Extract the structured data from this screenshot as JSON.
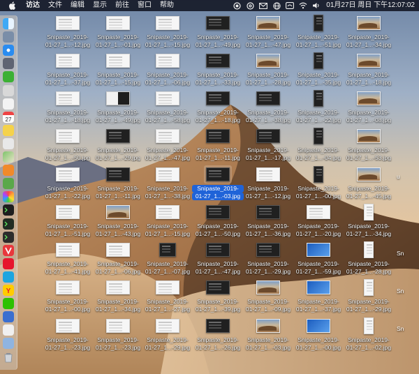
{
  "menubar": {
    "app_name": "访达",
    "items": [
      "文件",
      "编辑",
      "显示",
      "前往",
      "窗口",
      "帮助"
    ],
    "clock": "01月27日 周日 下午12:07:02",
    "tray_icons": [
      "record-icon",
      "bullseye-icon",
      "mail-icon",
      "globe-icon",
      "hotspot-icon",
      "wifi-icon",
      "volume-icon"
    ]
  },
  "dock": {
    "apps": [
      "finder-icon",
      "launchpad-icon",
      "safari-icon",
      "rocket-icon",
      "wechat-icon",
      "notes-icon",
      "reminders-icon",
      "calendar-icon",
      "notes-yellow-icon",
      "preview-icon",
      "maps-icon",
      "books-icon",
      "time-machine-icon",
      "photos-icon",
      "terminal-icon",
      "activity-monitor-icon",
      "console-icon",
      "vivaldi-icon",
      "weibo-icon",
      "browser-icon",
      "yandex-icon",
      "wechat-green-icon",
      "keynote-icon",
      "document-icon",
      "downloads-icon",
      "trash-icon"
    ]
  },
  "desktop": {
    "rows": [
      [
        {
          "line1": "Snipaste_2019-",
          "line2": "01-27_1...-12.jpg",
          "thumb": "light",
          "shape": "wide"
        },
        {
          "line1": "Snipaste_2019-",
          "line2": "01-27_1...-01.jpg",
          "thumb": "light",
          "shape": "wide"
        },
        {
          "line1": "Snipaste_2019-",
          "line2": "01-27_1...-15.jpg",
          "thumb": "light",
          "shape": "wide"
        },
        {
          "line1": "Snipaste_2019-",
          "line2": "01-27_1...-49.jpg",
          "thumb": "dark",
          "shape": "wide"
        },
        {
          "line1": "Snipaste_2019-",
          "line2": "01-27_1...-47.jpg",
          "thumb": "photo",
          "shape": "wide"
        },
        {
          "line1": "Snipaste_2019-",
          "line2": "01-27_1...-51.jpg",
          "thumb": "dark",
          "shape": "tall"
        },
        {
          "line1": "Snipaste_2019-",
          "line2": "01-27_1...-34.jpg",
          "thumb": "photo",
          "shape": "wide"
        }
      ],
      [
        {
          "line1": "Snipaste_2019-",
          "line2": "01-27_1...-37.jpg",
          "thumb": "light",
          "shape": "wide"
        },
        {
          "line1": "Snipaste_2019-",
          "line2": "01-27_1...-15.jpg",
          "thumb": "light",
          "shape": "wide"
        },
        {
          "line1": "Snipaste_2019-",
          "line2": "01-27_1...-06.jpg",
          "thumb": "light",
          "shape": "wide"
        },
        {
          "line1": "Snipaste_2019-",
          "line2": "01-27_1...-33.jpg",
          "thumb": "dark",
          "shape": "wide"
        },
        {
          "line1": "Snipaste_2019-",
          "line2": "01-27_1...-28.jpg",
          "thumb": "photo",
          "shape": "wide"
        },
        {
          "line1": "Snipaste_2019-",
          "line2": "01-27_1...-35.jpg",
          "thumb": "dark",
          "shape": "tall"
        },
        {
          "line1": "Snipaste_2019-",
          "line2": "01-27_1...-18.jpg",
          "thumb": "photo",
          "shape": "wide"
        }
      ],
      [
        {
          "line1": "Snipaste_2019-",
          "line2": "01-27_1...-18.jpg",
          "thumb": "light",
          "shape": "wide"
        },
        {
          "line1": "Snipaste_2019-",
          "line2": "01-27_1...-49.jpg",
          "thumb": "split",
          "shape": "wide"
        },
        {
          "line1": "Snipaste_2019-",
          "line2": "01-27_1...-58.jpg",
          "thumb": "light",
          "shape": "wide"
        },
        {
          "line1": "Snipaste_2019-",
          "line2": "01-27_1...-18.jpg",
          "thumb": "dark",
          "shape": "wide"
        },
        {
          "line1": "Snipaste_2019-",
          "line2": "01-27_1...-38.jpg",
          "thumb": "dark",
          "shape": "wide"
        },
        {
          "line1": "Snipaste_2019-",
          "line2": "01-27_1...-22.jpg",
          "thumb": "dark",
          "shape": "tall"
        },
        {
          "line1": "Snipaste_2019-",
          "line2": "01-27_1...-08.jpg",
          "thumb": "photo",
          "shape": "wide"
        }
      ],
      [
        {
          "line1": "Snipaste_2019-",
          "line2": "01-27_1...-50.jpg",
          "thumb": "light",
          "shape": "wide"
        },
        {
          "line1": "Snipaste_2019-",
          "line2": "01-27_1...-29.jpg",
          "thumb": "dark",
          "shape": "wide"
        },
        {
          "line1": "Snipaste_2019-",
          "line2": "01-27_1...-47.jpg",
          "thumb": "light",
          "shape": "wide"
        },
        {
          "line1": "Snipaste_2019-",
          "line2": "01-27_1...-11.jpg",
          "thumb": "dark",
          "shape": "wide"
        },
        {
          "line1": "Snipaste_2019-",
          "line2": "01-27_1...-17.jpg",
          "thumb": "dark",
          "shape": "wide"
        },
        {
          "line1": "Snipaste_2019-",
          "line2": "01-27_1...-04.jpg",
          "thumb": "dark",
          "shape": "tall"
        },
        {
          "line1": "Snipaste_2019-",
          "line2": "01-27_1...-53.jpg",
          "thumb": "photo",
          "shape": "wide"
        }
      ],
      [
        {
          "line1": "Snipaste_2019-",
          "line2": "01-27_1...-22.jpg",
          "thumb": "light",
          "shape": "wide"
        },
        {
          "line1": "Snipaste_2019-",
          "line2": "01-27_1...-11.jpg",
          "thumb": "dark",
          "shape": "wide"
        },
        {
          "line1": "Snipaste_2019-",
          "line2": "01-27_1...-38.jpg",
          "thumb": "light",
          "shape": "wide"
        },
        {
          "line1": "Snipaste_2019-",
          "line2": "01-27_1...-03.jpg",
          "thumb": "dark",
          "shape": "wide",
          "selected": true
        },
        {
          "line1": "Snipaste_2019-",
          "line2": "01-27_1...-12.jpg",
          "thumb": "light",
          "shape": "wide"
        },
        {
          "line1": "Snipaste_2019-",
          "line2": "01-27_1...-00.jpg",
          "thumb": "dark",
          "shape": "tall"
        },
        {
          "line1": "Snipaste_2019-",
          "line2": "01-27_1...-45.jpg",
          "thumb": "photo",
          "shape": "wide"
        }
      ],
      [
        {
          "line1": "Snipaste_2019-",
          "line2": "01-27_1...-51.jpg",
          "thumb": "light",
          "shape": "wide"
        },
        {
          "line1": "Snipaste_2019-",
          "line2": "01-27_1...-43.jpg",
          "thumb": "photo",
          "shape": "wide"
        },
        {
          "line1": "Snipaste_2019-",
          "line2": "01-27_1...-15.jpg",
          "thumb": "light",
          "shape": "wide"
        },
        {
          "line1": "Snipaste_2019-",
          "line2": "01-27_1...-50.jpg",
          "thumb": "dark",
          "shape": "wide"
        },
        {
          "line1": "Snipaste_2019-",
          "line2": "01-27_1...-36.jpg",
          "thumb": "dark",
          "shape": "wide"
        },
        {
          "line1": "Snipaste_2019-",
          "line2": "01-27_1...-20.jpg",
          "thumb": "light",
          "shape": "wide"
        },
        {
          "line1": "Snipaste_2019-",
          "line2": "01-27_1...-34.jpg",
          "thumb": "light",
          "shape": "tall"
        }
      ],
      [
        {
          "line1": "Snipaste_2019-",
          "line2": "01-27_1...-41.jpg",
          "thumb": "light",
          "shape": "wide"
        },
        {
          "line1": "Snipaste_2019-",
          "line2": "01-27_1...-06.jpg",
          "thumb": "light",
          "shape": "wide"
        },
        {
          "line1": "Snipaste_2019-",
          "line2": "01-27_1...-07.jpg",
          "thumb": "dark",
          "shape": "square"
        },
        {
          "line1": "Snipaste_2019-",
          "line2": "01-27_1...-47.jpg",
          "thumb": "dark",
          "shape": "wide"
        },
        {
          "line1": "Snipaste_2019-",
          "line2": "01-27_1...-29.jpg",
          "thumb": "dark",
          "shape": "wide"
        },
        {
          "line1": "Snipaste_2019-",
          "line2": "01-27_1...-59.jpg",
          "thumb": "blue",
          "shape": "wide"
        },
        {
          "line1": "Snipaste_2019-",
          "line2": "01-27_1...-28.jpg",
          "thumb": "light",
          "shape": "tall"
        }
      ],
      [
        {
          "line1": "Snipaste_2019-",
          "line2": "01-27_1...-00.jpg",
          "thumb": "light",
          "shape": "wide"
        },
        {
          "line1": "Snipaste_2019-",
          "line2": "01-27_1...-34.jpg",
          "thumb": "light",
          "shape": "wide"
        },
        {
          "line1": "Snipaste_2019-",
          "line2": "01-27_1...-27.jpg",
          "thumb": "light",
          "shape": "wide"
        },
        {
          "line1": "Snipaste_2019-",
          "line2": "01-27_1...-39.jpg",
          "thumb": "dark",
          "shape": "wide"
        },
        {
          "line1": "Snipaste_2019-",
          "line2": "01-27_1...-09.jpg",
          "thumb": "photo",
          "shape": "wide"
        },
        {
          "line1": "Snipaste_2019-",
          "line2": "01-27_1...-37.jpg",
          "thumb": "blue",
          "shape": "wide"
        },
        {
          "line1": "Snipaste_2019-",
          "line2": "01-27_1...-29.jpg",
          "thumb": "light",
          "shape": "tall"
        }
      ],
      [
        {
          "line1": "Snipaste_2019-",
          "line2": "01-27_1...-23.jpg",
          "thumb": "light",
          "shape": "wide"
        },
        {
          "line1": "Snipaste_2019-",
          "line2": "01-27_1...-23.jpg",
          "thumb": "light",
          "shape": "wide"
        },
        {
          "line1": "Snipaste_2019-",
          "line2": "01-27_1...-29.jpg",
          "thumb": "light",
          "shape": "wide"
        },
        {
          "line1": "Snipaste_2019-",
          "line2": "01-27_1...-26.jpg",
          "thumb": "dark",
          "shape": "wide"
        },
        {
          "line1": "Snipaste_2019-",
          "line2": "01-27_1...-03.jpg",
          "thumb": "photo",
          "shape": "wide"
        },
        {
          "line1": "Snipaste_2019-",
          "line2": "01-27_1...-00.jpg",
          "thumb": "blue",
          "shape": "wide"
        },
        {
          "line1": "Snipaste_2019-",
          "line2": "01-27_1...-02.jpg",
          "thumb": "light",
          "shape": "tall"
        }
      ]
    ],
    "edge_labels": [
      "u",
      "Sn",
      "Sn",
      "Sn",
      "Sn"
    ]
  },
  "colors": {
    "selection": "#1f63d8",
    "menubar": "#161a28"
  }
}
